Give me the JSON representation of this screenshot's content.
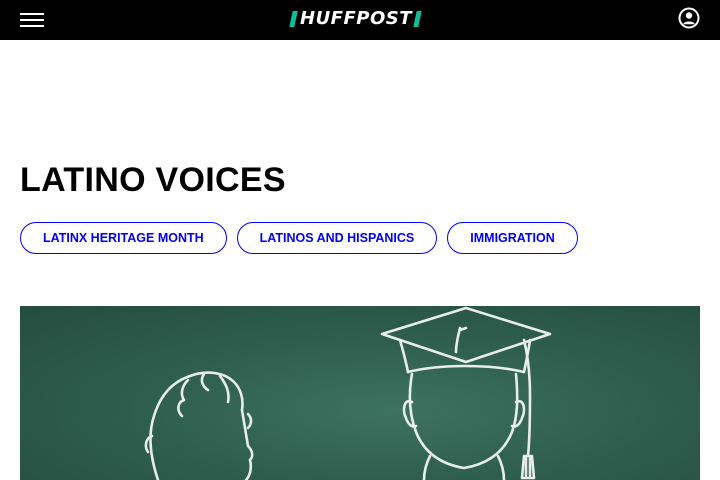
{
  "header": {
    "logo_text": "HUFFPOST",
    "menu_icon": "hamburger-menu-icon",
    "account_icon": "user-account-icon",
    "background": "#000000",
    "logo_accent": "#0dbe98"
  },
  "section": {
    "title": "LATINO VOICES"
  },
  "tags": [
    {
      "label": "LATINX HERITAGE MONTH"
    },
    {
      "label": "LATINOS AND HISPANICS"
    },
    {
      "label": "IMMIGRATION"
    }
  ],
  "tag_color": "#0000ff",
  "hero": {
    "image": "chalkboard-drawing-graduates",
    "background": "#2f5f4f"
  }
}
